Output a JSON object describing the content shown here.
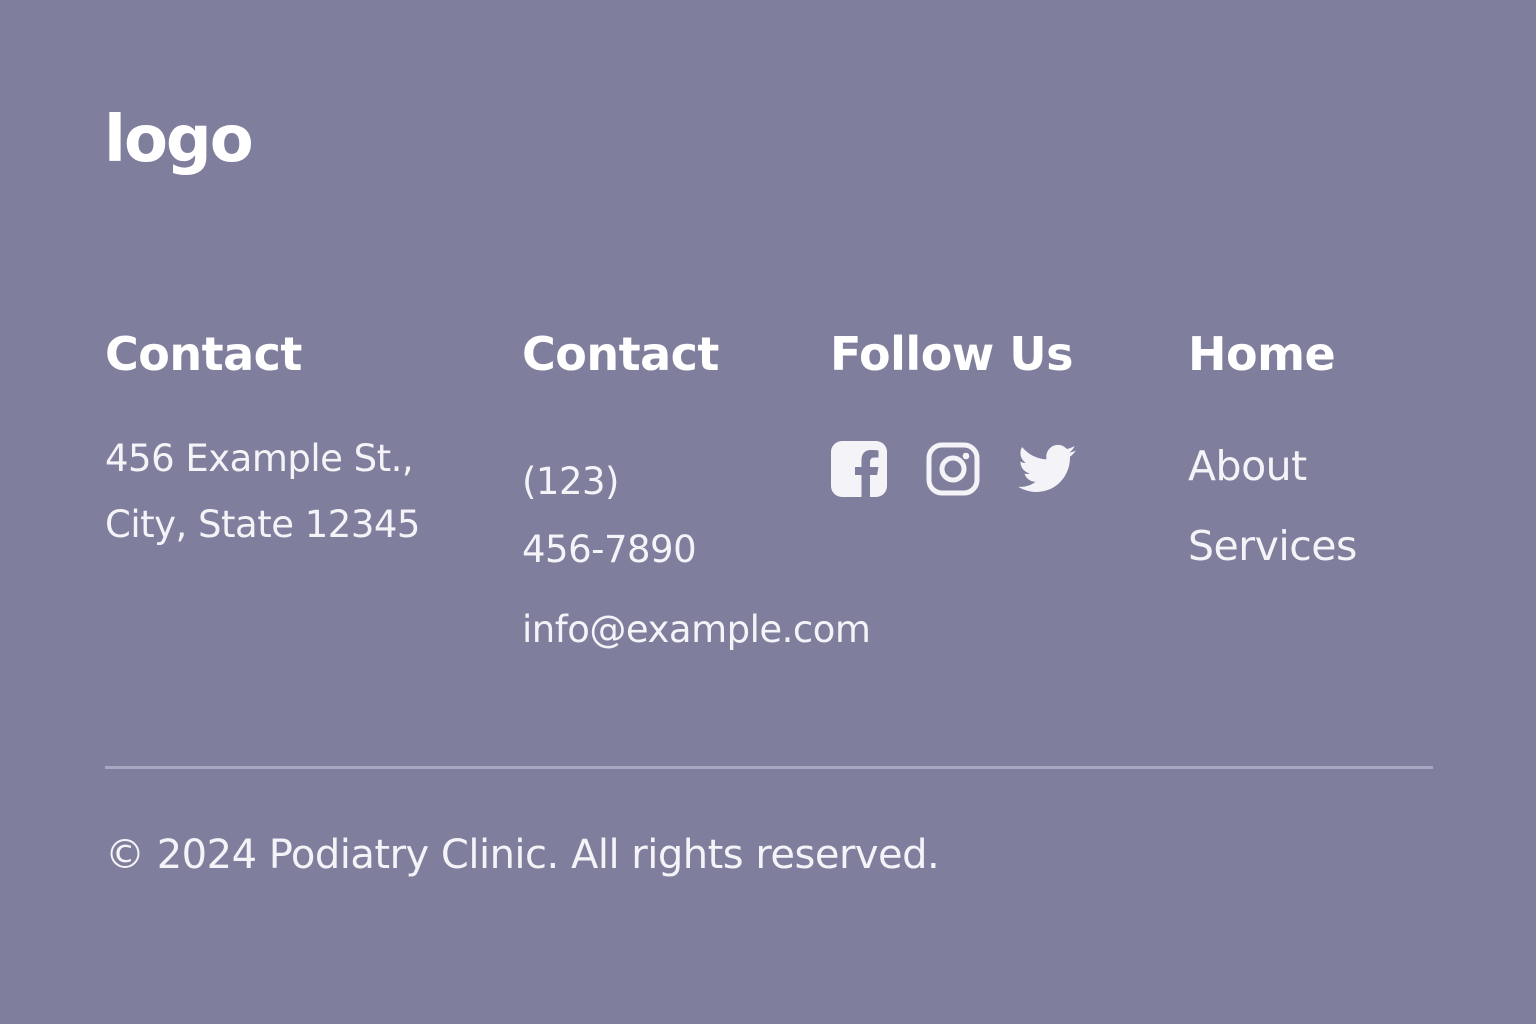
{
  "brand": {
    "logo_text": "logo"
  },
  "columns": {
    "address": {
      "heading": "Contact",
      "lines": [
        "456 Example St.,",
        "City, State 12345"
      ]
    },
    "contact": {
      "heading": "Contact",
      "phone_lines": [
        "(123)",
        "456-7890"
      ],
      "email": "info@example.com"
    },
    "follow": {
      "heading": "Follow Us",
      "icons": [
        "facebook-icon",
        "instagram-icon",
        "twitter-icon"
      ]
    },
    "nav": {
      "heading": "Home",
      "items": [
        "About",
        "Services"
      ]
    }
  },
  "footer": {
    "copyright": "© 2024 Podiatry Clinic. All rights reserved."
  },
  "colors": {
    "background": "#7f7e9c",
    "text": "#f4f3f8",
    "divider": "#a8a7bf"
  }
}
